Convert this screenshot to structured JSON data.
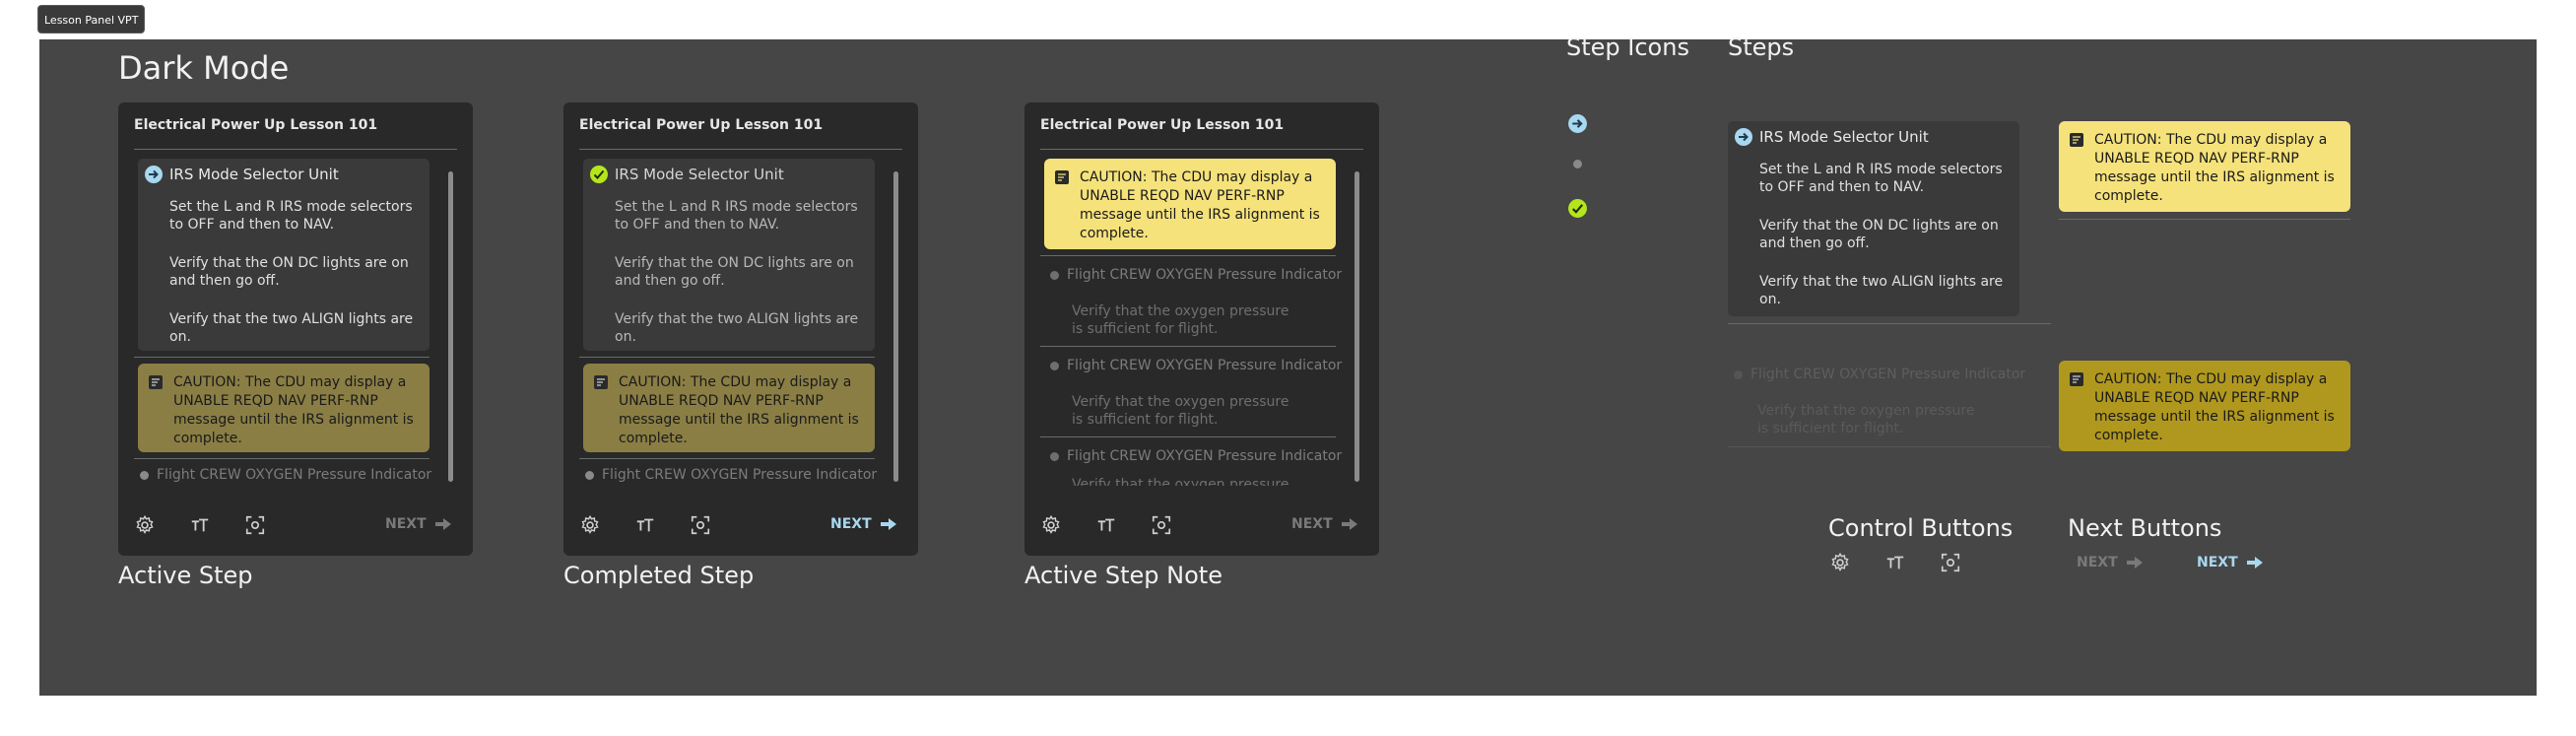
{
  "badge": "Lesson Panel VPT",
  "headings": {
    "dark_mode": "Dark Mode",
    "step_icons": "Step Icons",
    "steps": "Steps",
    "control_buttons": "Control Buttons",
    "next_buttons": "Next Buttons"
  },
  "panel_title": "Electrical Power Up Lesson 101",
  "step": {
    "title": "IRS Mode Selector Unit",
    "items": [
      "Set the L and R IRS mode selectors to OFF and then to NAV.",
      "Verify that the ON DC lights are on and then go off.",
      "Verify that the two ALIGN lights are on."
    ]
  },
  "caution_text": "CAUTION: The CDU may display a UNABLE REQD NAV PERF-RNP message until the IRS alignment is complete.",
  "oxygen": {
    "title": "Flight CREW OXYGEN Pressure Indicator",
    "item": "Verify that the oxygen pressure is sufficient for flight.",
    "item_cut": "Verify that the oxygen pressure is"
  },
  "next_label": "NEXT",
  "captions": {
    "active_step": "Active Step",
    "completed_step": "Completed Step",
    "active_step_note": "Active Step Note"
  },
  "icons": {
    "settings": "gear-icon",
    "text_size": "text-size-icon",
    "focus": "focus-frame-icon",
    "note": "note-icon",
    "arrow": "arrow-right-icon",
    "active_step": "arrow-circle-icon",
    "completed_step": "check-circle-icon"
  },
  "colors": {
    "canvas": "#464646",
    "panel": "#292929",
    "active_blue": "#a8d8f0",
    "completed_green": "#b5e61d",
    "caution_bright": "#f5e27a",
    "caution_muted": "#8a7e45",
    "caution_dark": "#b0981f"
  }
}
